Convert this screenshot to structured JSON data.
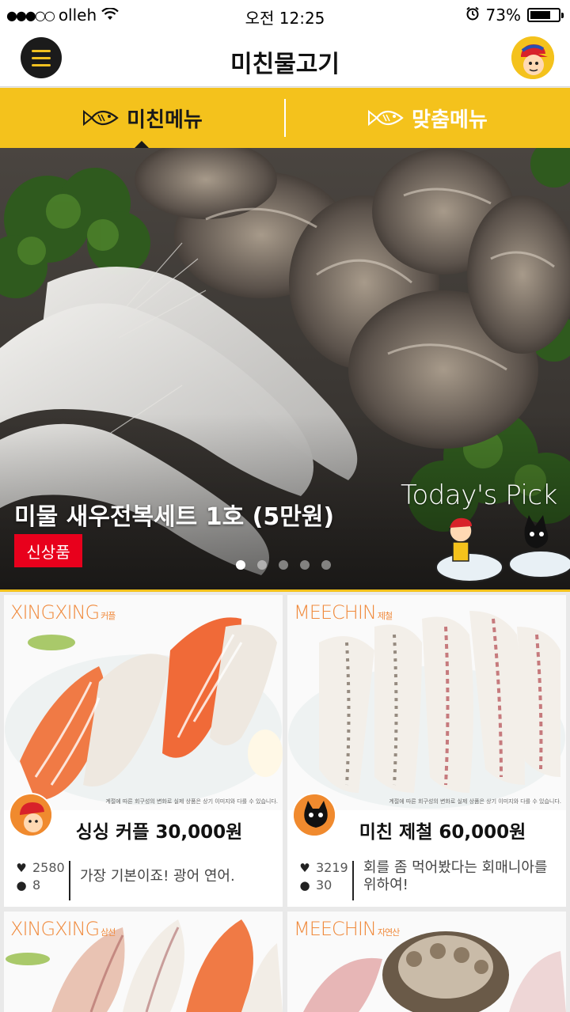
{
  "status_bar": {
    "carrier": "olleh",
    "signal_dots": "●●●○○",
    "time": "오전 12:25",
    "battery": "73%",
    "battery_level": 0.73
  },
  "nav": {
    "title": "미친물고기",
    "menu_icon": "hamburger-icon",
    "profile_icon": "avatar-icon"
  },
  "tabs": [
    {
      "label": "미친메뉴",
      "icon": "fish-icon",
      "active": true
    },
    {
      "label": "맞춤메뉴",
      "icon": "fish-icon",
      "active": false
    }
  ],
  "hero": {
    "title": "미물 새우전복세트 1호 (5만원)",
    "badge": "신상품",
    "tagline": "Today's Pick",
    "dots": 5,
    "active_dot": 1
  },
  "cards": [
    {
      "brand": "XINGXING",
      "brand_sub": "커플",
      "name": "싱싱 커플 30,000원",
      "likes": "2580",
      "comments": "8",
      "desc": "가장 기본이죠! 광어 연어.",
      "fine_print": "계절에 따른 회구성의 변화로 실제 상품은 상기 이미지와 다를 수 있습니다."
    },
    {
      "brand": "MEECHIN",
      "brand_sub": "제철",
      "name": "미친 제철 60,000원",
      "likes": "3219",
      "comments": "30",
      "desc": "회를 좀 먹어봤다는 회매니아를 위하여!",
      "fine_print": "계절에 따른 회구성의 변화로 실제 상품은 상기 이미지와 다를 수 있습니다."
    },
    {
      "brand": "XINGXING",
      "brand_sub": "삼선"
    },
    {
      "brand": "MEECHIN",
      "brand_sub": "자연산"
    }
  ],
  "colors": {
    "accent": "#f4c21c",
    "badge_red": "#e8001c",
    "brand_orange": "#f08a3c"
  }
}
